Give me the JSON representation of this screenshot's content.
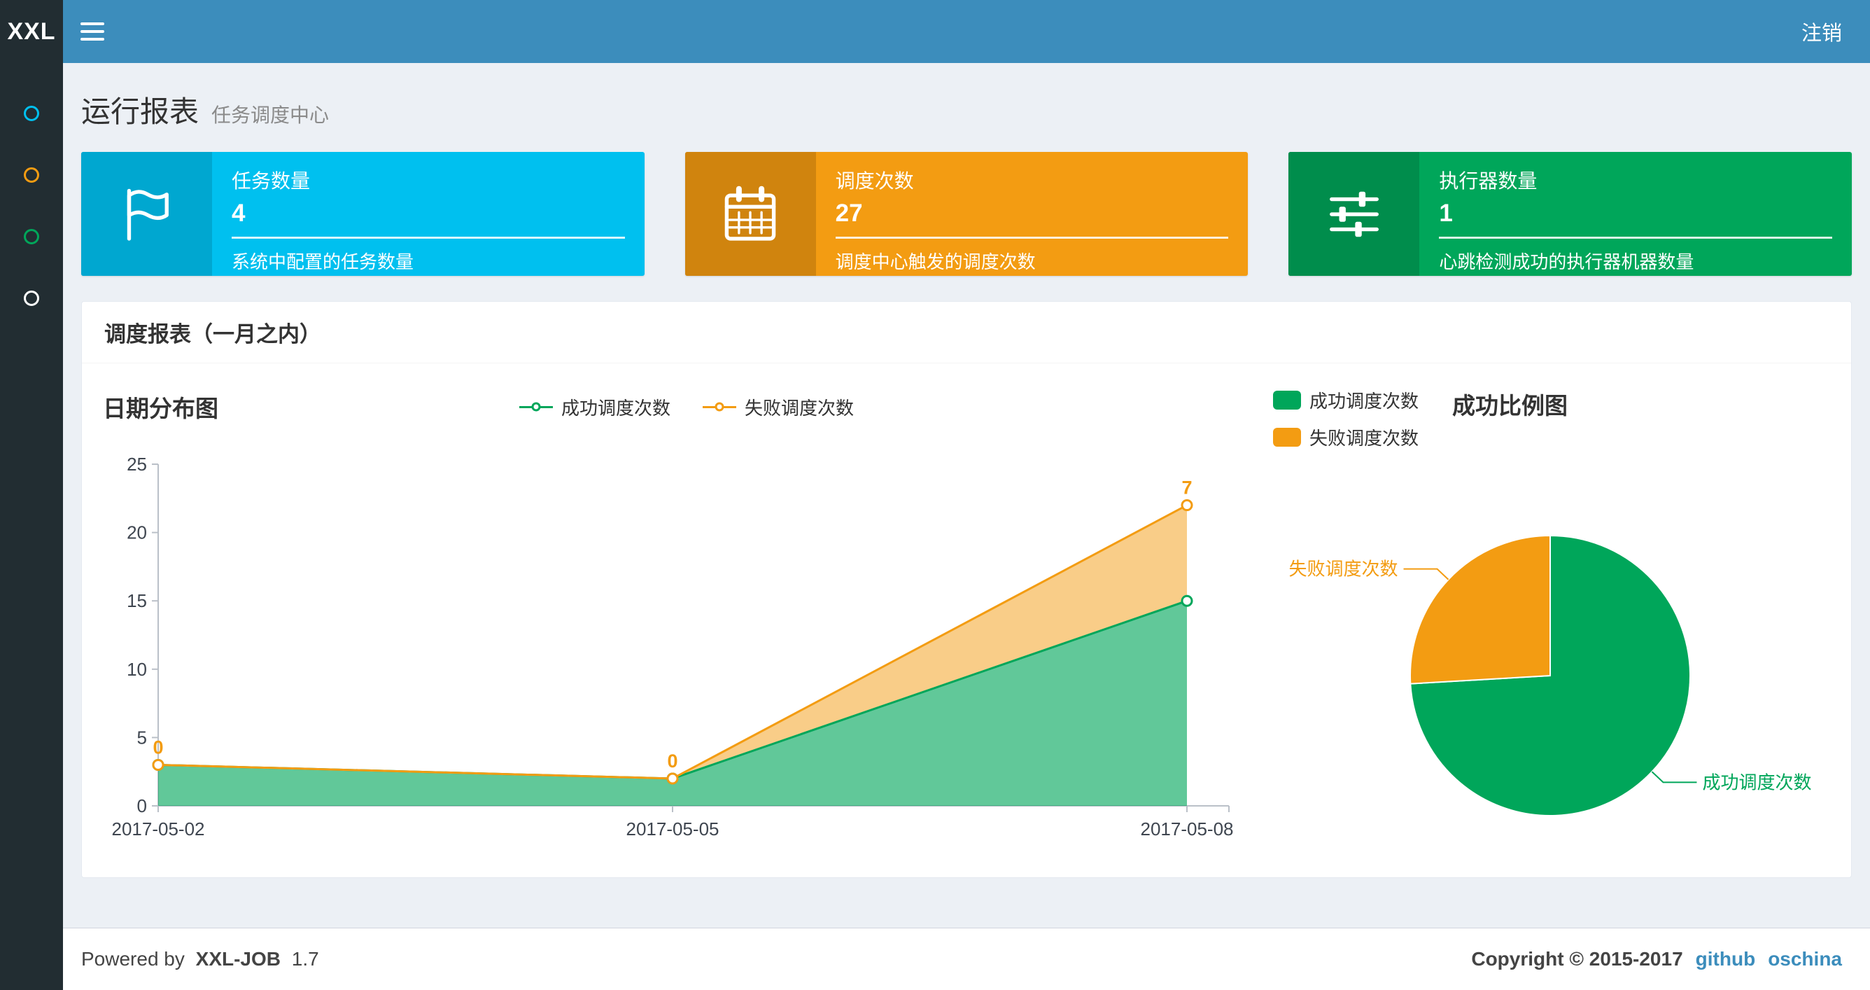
{
  "navbar": {
    "logo_text": "XXL",
    "logout_label": "注销"
  },
  "sidebar": {
    "items": [
      {
        "name": "menu-item-1",
        "icon": "circle-o-icon",
        "color": "#00c0ef"
      },
      {
        "name": "menu-item-2",
        "icon": "circle-o-icon",
        "color": "#f39c12"
      },
      {
        "name": "menu-item-3",
        "icon": "circle-o-icon",
        "color": "#00a65a"
      },
      {
        "name": "menu-item-4",
        "icon": "circle-o-icon",
        "color": "#ffffff"
      }
    ]
  },
  "page_header": {
    "title": "运行报表",
    "subtitle": "任务调度中心"
  },
  "info_boxes": [
    {
      "icon": "flag-icon",
      "title": "任务数量",
      "value": "4",
      "description": "系统中配置的任务数量",
      "color": "#00c0ef",
      "icon_color": "#00a7d0"
    },
    {
      "icon": "calendar-icon",
      "title": "调度次数",
      "value": "27",
      "description": "调度中心触发的调度次数",
      "color": "#f39c12",
      "icon_color": "#d0840e"
    },
    {
      "icon": "sliders-icon",
      "title": "执行器数量",
      "value": "1",
      "description": "心跳检测成功的执行器机器数量",
      "color": "#00a65a",
      "icon_color": "#008d4c"
    }
  ],
  "panel": {
    "title": "调度报表（一月之内）"
  },
  "chart_data": [
    {
      "type": "area",
      "title": "日期分布图",
      "x": [
        "2017-05-02",
        "2017-05-05",
        "2017-05-08"
      ],
      "series": [
        {
          "name": "成功调度次数",
          "values": [
            3,
            2,
            15
          ],
          "color": "#00a65a",
          "stack": true
        },
        {
          "name": "失败调度次数",
          "values": [
            0,
            0,
            7
          ],
          "color": "#f39c12",
          "stack": true,
          "labels": [
            "0",
            "0",
            "7"
          ]
        }
      ],
      "ylim": [
        0,
        25
      ],
      "ytick_step": 5,
      "grid": false,
      "legend_position": "top-center"
    },
    {
      "type": "pie",
      "title": "成功比例图",
      "slices": [
        {
          "name": "成功调度次数",
          "value": 20,
          "color": "#00a65a"
        },
        {
          "name": "失败调度次数",
          "value": 7,
          "color": "#f39c12"
        }
      ],
      "legend_position": "top-left",
      "start_angle": "top",
      "direction": "clockwise"
    }
  ],
  "footer": {
    "powered_prefix": "Powered by",
    "brand": "XXL-JOB",
    "version": "1.7",
    "copyright": "Copyright © 2015-2017",
    "links": [
      {
        "label": "github"
      },
      {
        "label": "oschina"
      }
    ]
  },
  "colors": {
    "navbar": "#3c8dbc",
    "sidebar": "#222d32",
    "content_bg": "#ecf0f5",
    "success": "#00a65a",
    "warning": "#f39c12",
    "info": "#00c0ef",
    "link": "#3c8dbc"
  }
}
